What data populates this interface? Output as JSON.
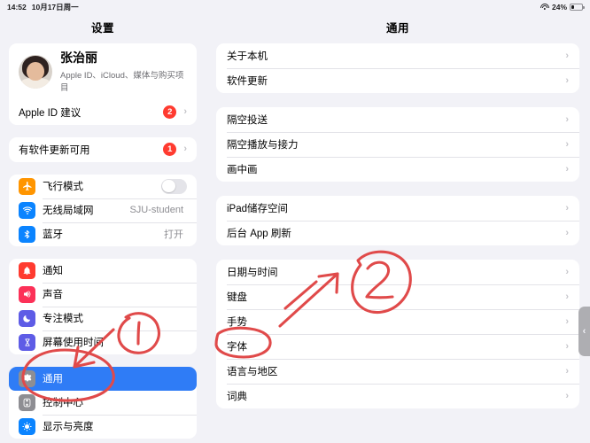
{
  "status_bar": {
    "time": "14:52",
    "date": "10月17日周一",
    "wifi_icon": "wifi-icon",
    "battery_percent": "24%",
    "battery_level": 24,
    "battery_icon": "battery-icon"
  },
  "sidebar": {
    "title": "设置",
    "account": {
      "name": "张治丽",
      "subtitle": "Apple ID、iCloud、媒体与购买项目",
      "avatar_name": "user-avatar",
      "suggestion": {
        "label": "Apple ID 建议",
        "badge": "2"
      }
    },
    "update": {
      "label": "有软件更新可用",
      "badge": "1"
    },
    "connectivity": [
      {
        "label": "飞行模式",
        "icon": "airplane-icon",
        "icon_color": "#ff9500",
        "control": "toggle",
        "toggle_on": false
      },
      {
        "label": "无线局域网",
        "icon": "wifi-icon",
        "icon_color": "#0b84ff",
        "value": "SJU-student"
      },
      {
        "label": "蓝牙",
        "icon": "bluetooth-icon",
        "icon_color": "#0b84ff",
        "value": "打开"
      }
    ],
    "preferences": [
      {
        "label": "通知",
        "icon": "bell-icon",
        "icon_color": "#ff3b30"
      },
      {
        "label": "声音",
        "icon": "speaker-icon",
        "icon_color": "#fc3158"
      },
      {
        "label": "专注模式",
        "icon": "moon-icon",
        "icon_color": "#5e5ce6"
      },
      {
        "label": "屏幕使用时间",
        "icon": "hourglass-icon",
        "icon_color": "#5e5ce6"
      }
    ],
    "system": [
      {
        "label": "通用",
        "icon": "gear-icon",
        "icon_color": "#8e8e93",
        "selected": true
      },
      {
        "label": "控制中心",
        "icon": "control-center-icon",
        "icon_color": "#8e8e93",
        "selected": false
      },
      {
        "label": "显示与亮度",
        "icon": "brightness-icon",
        "icon_color": "#0b84ff",
        "selected": false
      }
    ]
  },
  "detail": {
    "title": "通用",
    "groups": [
      {
        "items": [
          {
            "label": "关于本机"
          },
          {
            "label": "软件更新"
          }
        ]
      },
      {
        "items": [
          {
            "label": "隔空投送"
          },
          {
            "label": "隔空播放与接力"
          },
          {
            "label": "画中画"
          }
        ]
      },
      {
        "items": [
          {
            "label": "iPad储存空间"
          },
          {
            "label": "后台 App 刷新"
          }
        ]
      },
      {
        "items": [
          {
            "label": "日期与时间"
          },
          {
            "label": "键盘"
          },
          {
            "label": "手势",
            "annotated": true
          },
          {
            "label": "字体"
          },
          {
            "label": "语言与地区"
          },
          {
            "label": "词典"
          }
        ]
      }
    ],
    "drag_handle_glyph": "‹"
  },
  "annotations": {
    "ink_color": "#e04a4a",
    "marks": [
      {
        "name": "callout-1",
        "label": "1",
        "target": "通用"
      },
      {
        "name": "callout-2",
        "label": "2",
        "target": "手势"
      }
    ]
  }
}
